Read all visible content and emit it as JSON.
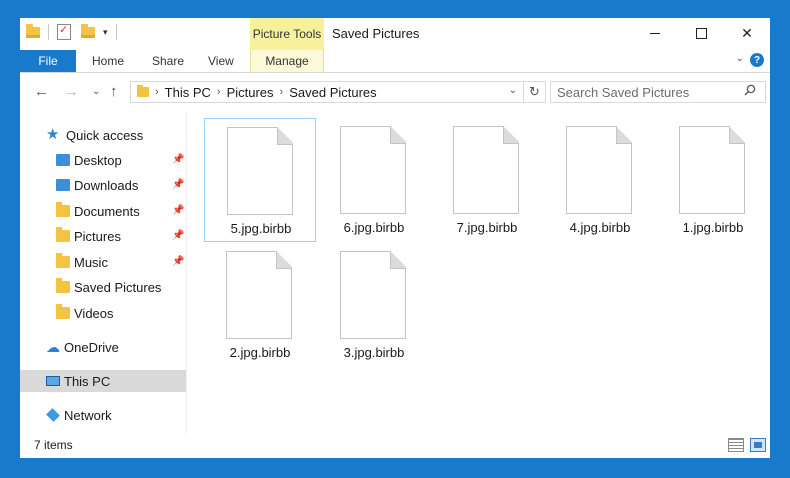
{
  "window": {
    "title": "Saved Pictures"
  },
  "titlebar": {
    "contextual_tab": "Picture Tools",
    "minimize": "—",
    "maximize": "☐",
    "close": "✕"
  },
  "ribbon": {
    "tabs": [
      "File",
      "Home",
      "Share",
      "View",
      "Manage"
    ],
    "help": "?"
  },
  "address": {
    "crumbs": [
      "This PC",
      "Pictures",
      "Saved Pictures"
    ]
  },
  "search": {
    "placeholder": "Search Saved Pictures"
  },
  "sidebar": {
    "quick_access": "Quick access",
    "items": [
      "Desktop",
      "Downloads",
      "Documents",
      "Pictures",
      "Music",
      "Saved Pictures",
      "Videos"
    ],
    "onedrive": "OneDrive",
    "this_pc": "This PC",
    "network": "Network"
  },
  "files": [
    {
      "name": "5.jpg.birbb"
    },
    {
      "name": "6.jpg.birbb"
    },
    {
      "name": "7.jpg.birbb"
    },
    {
      "name": "4.jpg.birbb"
    },
    {
      "name": "1.jpg.birbb"
    },
    {
      "name": "2.jpg.birbb"
    },
    {
      "name": "3.jpg.birbb"
    }
  ],
  "status": {
    "count_text": "7 items"
  },
  "icons": {
    "back": "back-arrow-icon",
    "forward": "forward-arrow-icon",
    "recent": "chevron-down-icon",
    "up": "up-arrow-icon",
    "refresh": "refresh-icon",
    "search": "search-icon"
  },
  "colors": {
    "accent": "#1979ca",
    "picture_tools": "#f8f19b",
    "selection": "#d9d9d9"
  }
}
